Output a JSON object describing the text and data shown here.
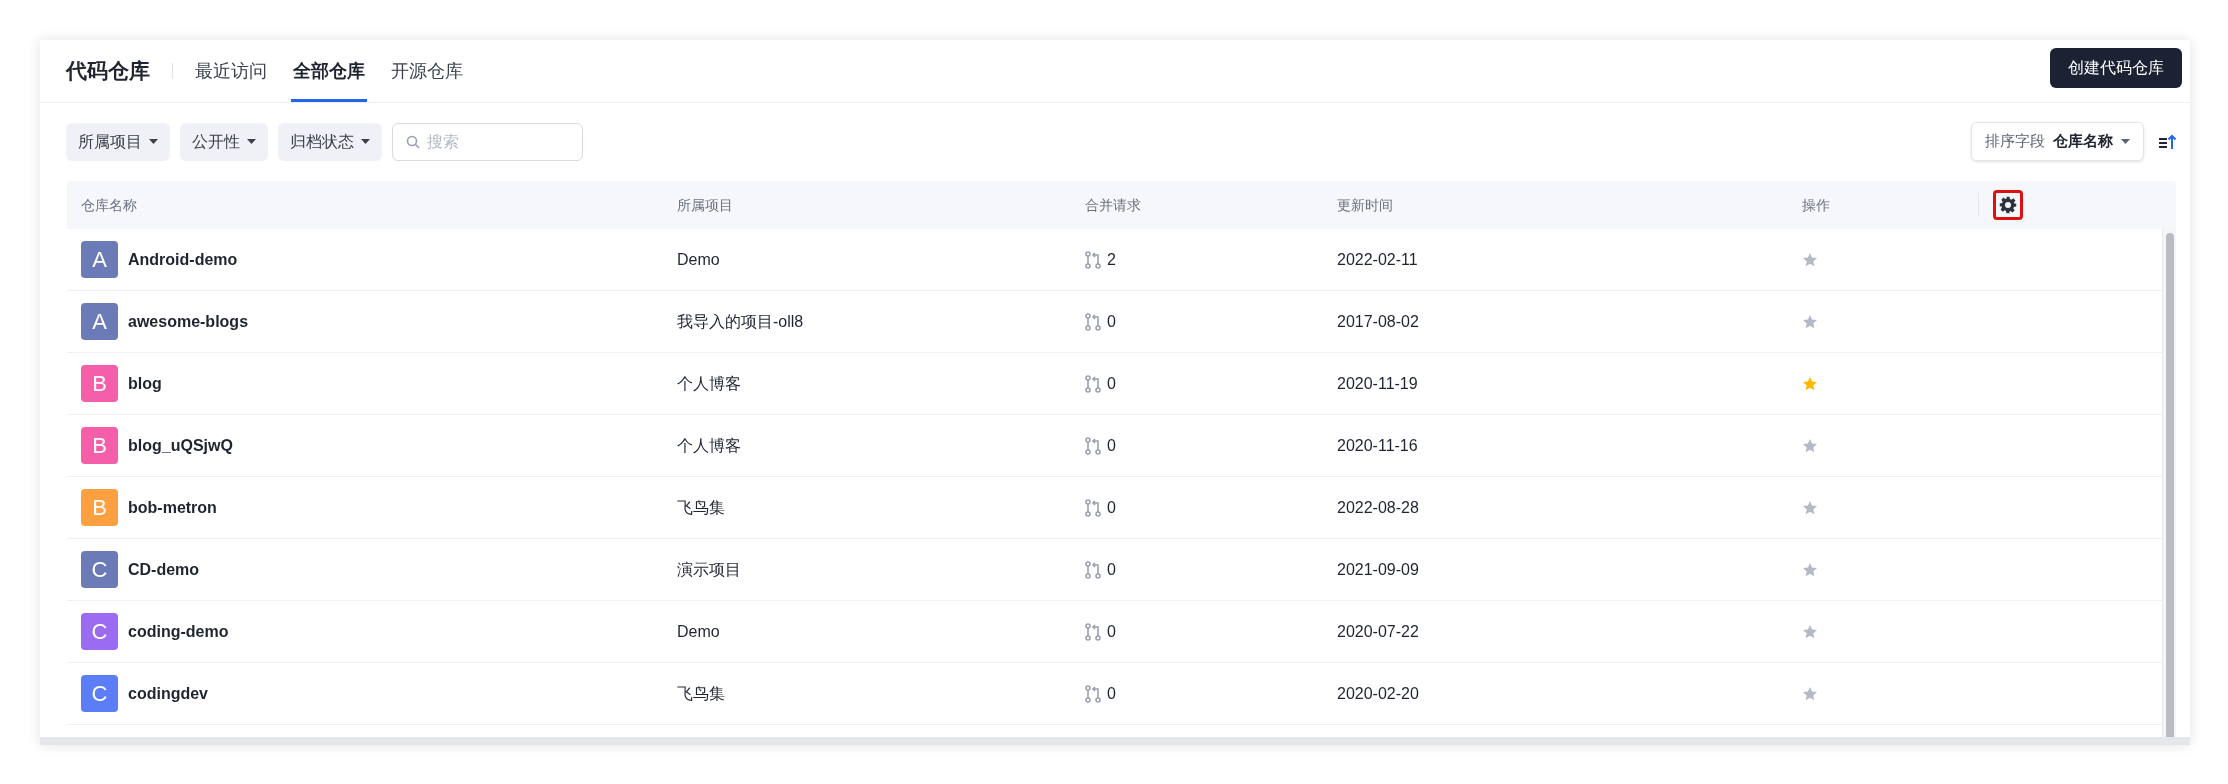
{
  "header": {
    "title": "代码仓库",
    "tabs": [
      {
        "label": "最近访问",
        "selected": false
      },
      {
        "label": "全部仓库",
        "selected": true
      },
      {
        "label": "开源仓库",
        "selected": false
      }
    ],
    "create_button": "创建代码仓库"
  },
  "filters": {
    "dropdowns": [
      "所属项目",
      "公开性",
      "归档状态"
    ],
    "search": {
      "placeholder": "搜索"
    },
    "sort": {
      "label": "排序字段",
      "value": "仓库名称"
    }
  },
  "table": {
    "columns": [
      "仓库名称",
      "所属项目",
      "合并请求",
      "更新时间",
      "操作"
    ],
    "settings": {
      "highlighted": true
    },
    "rows": [
      {
        "initial": "A",
        "color": "#6b7bb8",
        "name": "Android-demo",
        "project": "Demo",
        "merge_requests": "2",
        "updated": "2022-02-11",
        "starred": false
      },
      {
        "initial": "A",
        "color": "#6b7bb8",
        "name": "awesome-blogs",
        "project": "我导入的项目-oll8",
        "merge_requests": "0",
        "updated": "2017-08-02",
        "starred": false
      },
      {
        "initial": "B",
        "color": "#f55fa9",
        "name": "blog",
        "project": "个人博客",
        "merge_requests": "0",
        "updated": "2020-11-19",
        "starred": true
      },
      {
        "initial": "B",
        "color": "#f55fa9",
        "name": "blog_uQSjwQ",
        "project": "个人博客",
        "merge_requests": "0",
        "updated": "2020-11-16",
        "starred": false
      },
      {
        "initial": "B",
        "color": "#ffa040",
        "name": "bob-metron",
        "project": "飞鸟集",
        "merge_requests": "0",
        "updated": "2022-08-28",
        "starred": false
      },
      {
        "initial": "C",
        "color": "#6b7bb8",
        "name": "CD-demo",
        "project": "演示项目",
        "merge_requests": "0",
        "updated": "2021-09-09",
        "starred": false
      },
      {
        "initial": "C",
        "color": "#9b6cf2",
        "name": "coding-demo",
        "project": "Demo",
        "merge_requests": "0",
        "updated": "2020-07-22",
        "starred": false
      },
      {
        "initial": "C",
        "color": "#5b7df6",
        "name": "codingdev",
        "project": "飞鸟集",
        "merge_requests": "0",
        "updated": "2020-02-20",
        "starred": false
      }
    ]
  }
}
